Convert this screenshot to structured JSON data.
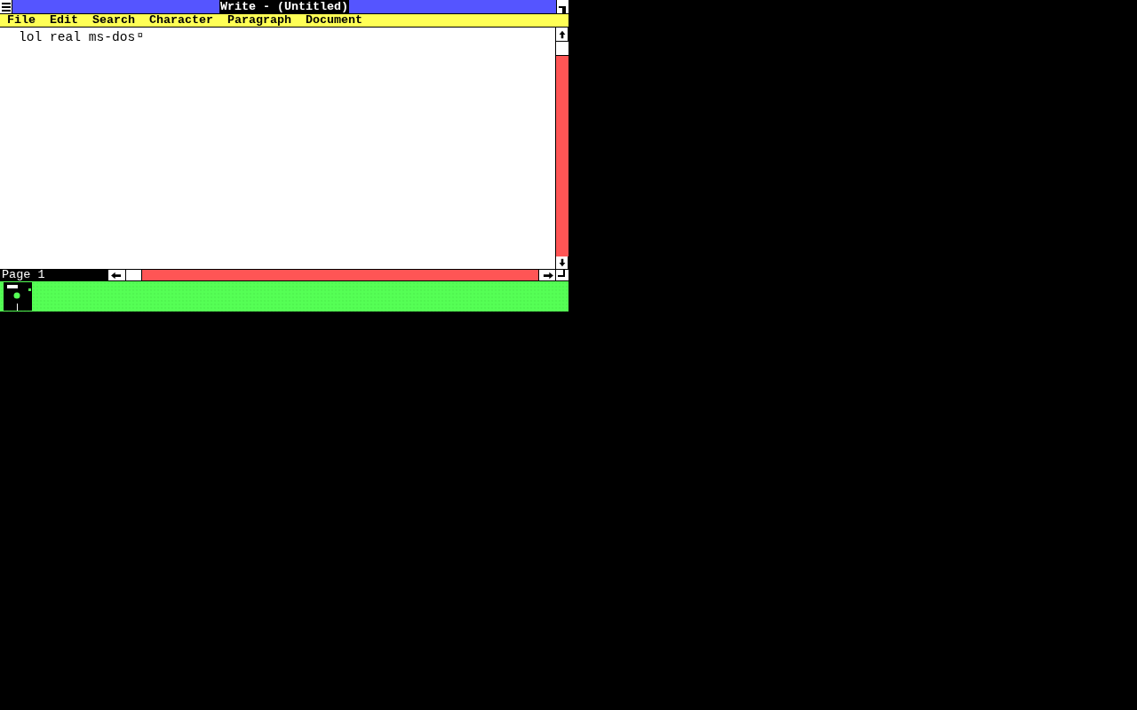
{
  "window": {
    "title": "Write - (Untitled)"
  },
  "menu": [
    "File",
    "Edit",
    "Search",
    "Character",
    "Paragraph",
    "Document"
  ],
  "document": {
    "text": "lol real ms-dos",
    "end_mark": "¤"
  },
  "status_bar": {
    "page": "Page 1"
  }
}
